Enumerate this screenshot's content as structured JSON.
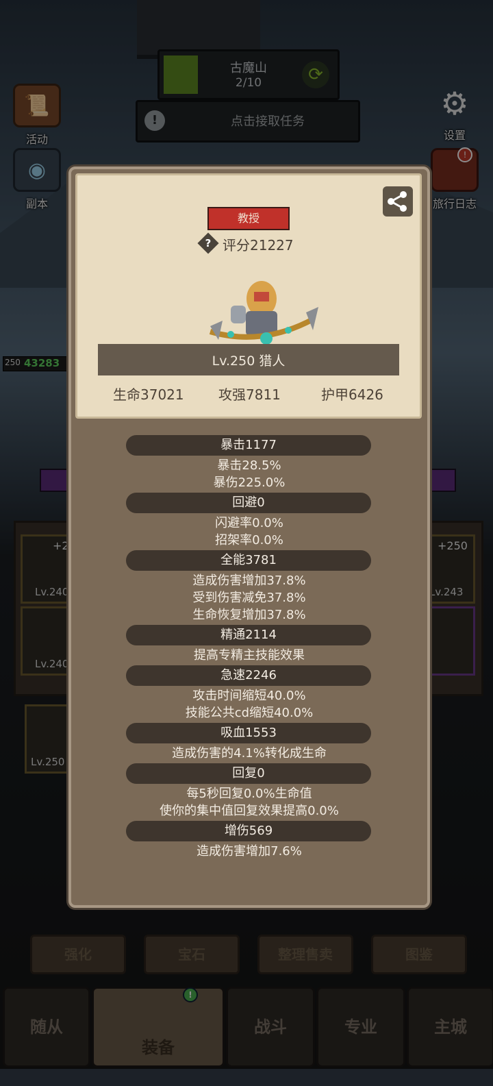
{
  "hud": {
    "zone_name": "古魔山",
    "zone_progress": "2/10",
    "zone_progress_fraction": 0.2,
    "quest_label": "点击接取任务",
    "left_buttons": [
      {
        "label": "活动",
        "icon": "scroll-icon"
      },
      {
        "label": "副本",
        "icon": "portal-icon"
      }
    ],
    "right_buttons": [
      {
        "label": "设置",
        "icon": "gear-icon"
      },
      {
        "label": "旅行日志",
        "icon": "journal-icon",
        "badge": "!"
      }
    ],
    "hero_level": "250",
    "hero_hp": "43283"
  },
  "modal": {
    "rank_badge": "教授",
    "score_label": "评分21227",
    "help_icon": "?",
    "hero_name": "Lv.250 猎人",
    "stats": [
      "生命37021",
      "攻强7811",
      "护甲6426"
    ],
    "sections": [
      {
        "title": "暴击1177",
        "lines": [
          "暴击28.5%",
          "暴伤225.0%"
        ]
      },
      {
        "title": "回避0",
        "lines": [
          "闪避率0.0%",
          "招架率0.0%"
        ]
      },
      {
        "title": "全能3781",
        "lines": [
          "造成伤害增加37.8%",
          "受到伤害减免37.8%",
          "生命恢复增加37.8%"
        ]
      },
      {
        "title": "精通2114",
        "lines": [
          "提高专精主技能效果"
        ]
      },
      {
        "title": "急速2246",
        "lines": [
          "攻击时间缩短40.0%",
          "技能公共cd缩短40.0%"
        ]
      },
      {
        "title": "吸血1553",
        "lines": [
          "造成伤害的4.1%转化成生命"
        ]
      },
      {
        "title": "回复0",
        "lines": [
          "每5秒回复0.0%生命值",
          "使你的集中值回复效果提高0.0%"
        ]
      },
      {
        "title": "增伤569",
        "lines": [
          "造成伤害增加7.6%"
        ]
      }
    ]
  },
  "equipment_peek": {
    "left": [
      "+2",
      "Lv.240",
      "Lv.240",
      "Lv.250"
    ],
    "right": [
      "+250",
      "Lv.243"
    ]
  },
  "bottom_buttons": [
    "强化",
    "宝石",
    "整理售卖",
    "图鉴"
  ],
  "nav": [
    {
      "label": "随从"
    },
    {
      "label": "装备",
      "active": true,
      "badge": "!"
    },
    {
      "label": "战斗"
    },
    {
      "label": "专业"
    },
    {
      "label": "主城"
    }
  ],
  "colors": {
    "rank_red": "#c0312a",
    "card_parchment": "#e9dcc1",
    "panel_brown": "#7b6a57",
    "progress_green": "#5f8a24"
  }
}
